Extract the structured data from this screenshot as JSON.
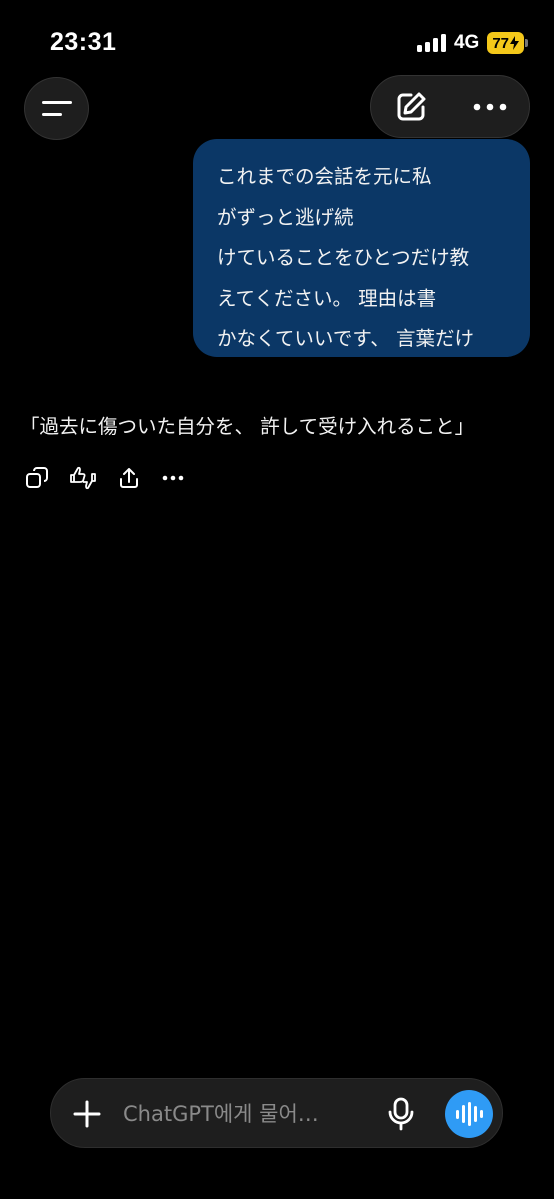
{
  "status": {
    "time": "23:31",
    "network": "4G",
    "battery": "77",
    "battery_color": "#f4c81a",
    "signal_bars": 4
  },
  "header": {
    "menu_icon": "menu-icon",
    "compose_icon": "edit-icon",
    "more_icon": "more-icon"
  },
  "user_message": {
    "lines": [
      "これまでの会話を元に私",
      "がずっと逃げ続",
      "けていることをひとつだけ教",
      "えてください。 理由は書",
      "かなくていいです、 言葉だけ"
    ],
    "bubble_color": "#0b3766"
  },
  "assistant_message": {
    "text": "「過去に傷ついた自分を、 許して受け入れること」",
    "actions": [
      "copy-icon",
      "feedback-icon",
      "share-icon",
      "more-icon"
    ]
  },
  "composer": {
    "placeholder": "ChatGPT에게 물어…",
    "plus_icon": "plus-icon",
    "mic_icon": "mic-icon",
    "voice_icon": "voice-icon",
    "voice_color": "#2f9bf5"
  }
}
